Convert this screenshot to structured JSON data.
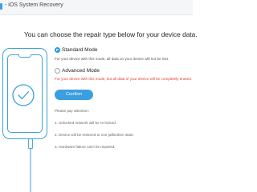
{
  "window": {
    "title": "- iOS System Recovery"
  },
  "main": {
    "headline": "You can choose the repair type below for your device data.",
    "options": [
      {
        "label": "Standard Mode",
        "description": "For your device with this mode, all data on your device will not be lost.",
        "selected": true
      },
      {
        "label": "Advanced Mode",
        "description": "For your device with this mode, but all data of your device will be completely erased.",
        "selected": false
      }
    ],
    "confirm_label": "Confirm",
    "notice_title": "Please pay attention:",
    "notice_items": [
      "1. Unlocked network will be re-locked.",
      "2. Device will be restored to non-jailbroken state.",
      "3. Hardware failure can't be repaired."
    ]
  },
  "colors": {
    "accent": "#3a9fe0",
    "warning": "#e53935"
  },
  "icons": {
    "illustration": "phone-icon",
    "status": "check-circle-icon"
  }
}
